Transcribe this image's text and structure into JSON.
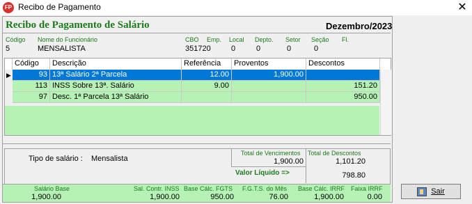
{
  "window": {
    "title": "Recibo de Pagamento",
    "icon_text": "FP",
    "close_glyph": "✕"
  },
  "header": {
    "title": "Recibo de Pagamento de Salário",
    "period": "Dezembro/2023"
  },
  "employee": {
    "codigo_label": "Código",
    "codigo": "5",
    "nome_label": "Nome do Funcionário",
    "nome": "MENSALISTA",
    "cbo_label": "CBO",
    "cbo": "351720",
    "emp_label": "Emp.",
    "local_label": "Local",
    "local": "0",
    "depto_label": "Depto.",
    "depto": "0",
    "setor_label": "Setor",
    "setor": "0",
    "secao_label": "Seção",
    "secao": "0",
    "fl_label": "Fl."
  },
  "grid": {
    "columns": [
      "Código",
      "Descrição",
      "Referência",
      "Proventos",
      "Descontos"
    ],
    "rows": [
      {
        "codigo": "93",
        "descricao": "13ª Salário 2ª Parcela",
        "referencia": "12.00",
        "proventos": "1,900.00",
        "descontos": ""
      },
      {
        "codigo": "113",
        "descricao": "INSS Sobre 13ª. Salário",
        "referencia": "9.00",
        "proventos": "",
        "descontos": "151.20"
      },
      {
        "codigo": "97",
        "descricao": "Desc. 1ª Parcela 13ª Salário",
        "referencia": "",
        "proventos": "",
        "descontos": "950.00"
      }
    ],
    "row_indicator": "▶"
  },
  "summary": {
    "tipo_label": "Tipo de salário :",
    "tipo": "Mensalista",
    "total_venc_label": "Total de Vencimentos",
    "total_venc": "1,900.00",
    "total_desc_label": "Total de Descontos",
    "total_desc": "1,101.20",
    "liquido_label": "Valor Líquido  =>",
    "liquido": "798.80"
  },
  "footer": {
    "salario_base_label": "Salário Base",
    "salario_base": "1,900.00",
    "sal_contr_label": "Sal. Contr. INSS",
    "sal_contr": "1,900.00",
    "base_fgts_label": "Base Cálc. FGTS",
    "base_fgts": "950.00",
    "fgts_mes_label": "F.G.T.S. do Mês",
    "fgts_mes": "76.00",
    "base_irrf_label": "Base Cálc. IRRF",
    "base_irrf": "1,900.00",
    "faixa_irrf_label": "Faixa IRRF",
    "faixa_irrf": "0.00"
  },
  "buttons": {
    "sair": "Sair"
  },
  "colors": {
    "accent_green": "#1a7a1a",
    "row_green": "#b6f1b6",
    "selected_blue": "#0078d7"
  }
}
